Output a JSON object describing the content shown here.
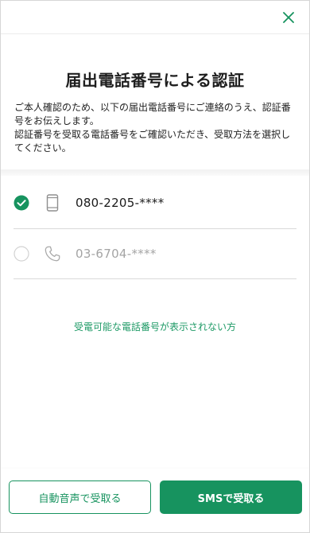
{
  "header": {
    "close_icon": "close-icon"
  },
  "content": {
    "title": "届出電話番号による認証",
    "description_line1": "ご本人確認のため、以下の届出電話番号にご連絡のうえ、認証番号をお伝えします。",
    "description_line2": "認証番号を受取る電話番号をご確認いただき、受取方法を選択してください。"
  },
  "phones": [
    {
      "number": "080-2205-****",
      "type_icon": "mobile-phone-icon",
      "selected": true
    },
    {
      "number": "03-6704-****",
      "type_icon": "landline-phone-icon",
      "selected": false
    }
  ],
  "help_link": "受電可能な電話番号が表示されない方",
  "footer": {
    "voice_button": "自動音声で受取る",
    "sms_button": "SMSで受取る"
  },
  "colors": {
    "accent": "#17935f",
    "link": "#1e9a66",
    "muted_text": "#a4a4a4"
  }
}
